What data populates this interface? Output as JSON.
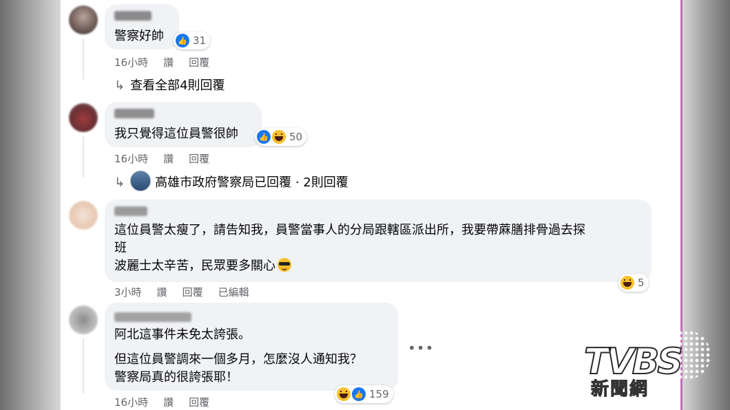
{
  "comments": [
    {
      "text": "警察好帥",
      "reactions": {
        "types": [
          "like-icon"
        ],
        "count": "31"
      },
      "meta": {
        "time": "16小時",
        "like": "讚",
        "reply": "回覆"
      },
      "replies_link": "查看全部4則回覆"
    },
    {
      "text": "我只覺得這位員警很帥",
      "reactions": {
        "types": [
          "like-icon",
          "haha-icon"
        ],
        "count": "50"
      },
      "meta": {
        "time": "16小時",
        "like": "讚",
        "reply": "回覆"
      },
      "replies_link": "高雄市政府警察局已回覆 · 2則回覆"
    },
    {
      "lines": [
        "這位員警太瘦了，請告知我，員警當事人的分局跟轄區派出所，我要帶蔴膳排骨過去探",
        "班",
        "波麗士太辛苦，民眾要多關心"
      ],
      "reactions": {
        "types": [
          "haha-icon"
        ],
        "count": "5"
      },
      "meta": {
        "time": "3小時",
        "like": "讚",
        "reply": "回覆",
        "edited": "已編輯"
      }
    },
    {
      "lines": [
        "阿北這事件未免太誇張。",
        "但這位員警調來一個多月，怎麼沒人通知我？",
        "警察局真的很誇張耶！"
      ],
      "reactions": {
        "types": [
          "haha-icon",
          "like-icon"
        ],
        "count": "159"
      },
      "meta": {
        "time": "16小時",
        "like": "讚",
        "reply": "回覆"
      },
      "more": "•••"
    }
  ],
  "logo": {
    "main": "TVBS",
    "sub": "新聞網"
  },
  "colors": {
    "bubble": "#f0f2f5",
    "like": "#1877f2",
    "haha": "#f7c02b",
    "meta": "#65676b"
  }
}
